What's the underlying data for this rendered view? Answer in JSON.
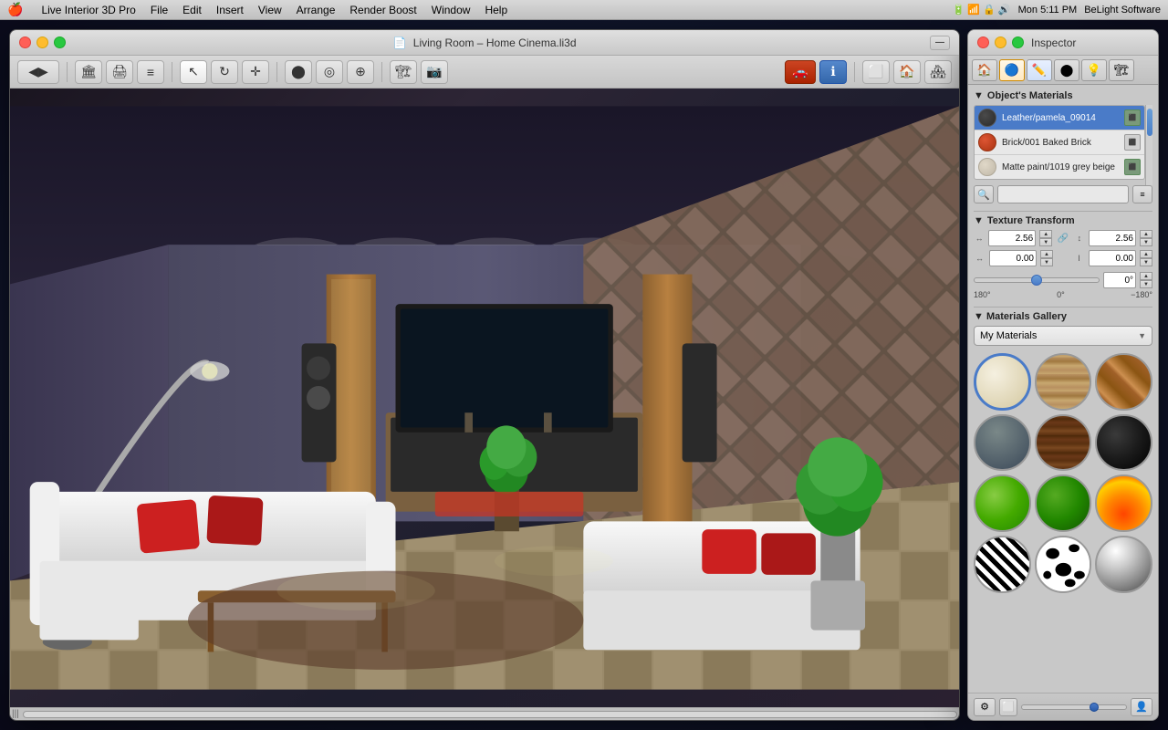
{
  "menubar": {
    "apple": "⌘",
    "app_name": "Live Interior 3D Pro",
    "menus": [
      "File",
      "Edit",
      "Insert",
      "View",
      "Arrange",
      "Render Boost",
      "Window",
      "Help"
    ],
    "right_items": [
      "🔋",
      "📶",
      "Mon 5:11 PM",
      "BeLight Software"
    ],
    "time": "Mon 5:11 PM",
    "brand": "BeLight Software"
  },
  "window": {
    "title": "Living Room – Home Cinema.li3d",
    "traffic_lights": [
      "red",
      "yellow",
      "green"
    ]
  },
  "inspector": {
    "title": "Inspector",
    "traffic_lights": [
      "red",
      "yellow",
      "green"
    ],
    "tabs": [
      "🏠",
      "🔵",
      "✏️",
      "⬤",
      "💡",
      "🏗️"
    ],
    "sections": {
      "materials": {
        "header": "Object's Materials",
        "items": [
          {
            "name": "Leather/pamela_09014",
            "color": "#3a3a3a",
            "type": "leather"
          },
          {
            "name": "Brick/001 Baked Brick",
            "color": "#cc4422",
            "type": "brick"
          },
          {
            "name": "Matte paint/1019 grey beige",
            "color": "#d4c8a8",
            "type": "paint"
          }
        ]
      },
      "texture_transform": {
        "header": "Texture Transform",
        "width_val": "2.56",
        "height_val": "2.56",
        "offset_x": "0.00",
        "offset_y": "0.00",
        "angle": "0°",
        "angle_label_left": "180°",
        "angle_label_center": "0°",
        "angle_label_right": "−180°"
      },
      "gallery": {
        "header": "Materials Gallery",
        "dropdown": "My Materials",
        "items": [
          {
            "name": "cream",
            "class": "mat-cream",
            "selected": true
          },
          {
            "name": "wood-light",
            "class": "mat-wood-light"
          },
          {
            "name": "brick",
            "class": "mat-brick"
          },
          {
            "name": "stone",
            "class": "mat-stone"
          },
          {
            "name": "wood-dark",
            "class": "mat-wood-dark"
          },
          {
            "name": "black",
            "class": "mat-black"
          },
          {
            "name": "green-bright",
            "class": "mat-green-bright"
          },
          {
            "name": "green-dark",
            "class": "mat-green-dark"
          },
          {
            "name": "fire",
            "class": "mat-fire"
          },
          {
            "name": "zebra",
            "class": "mat-zebra"
          },
          {
            "name": "dalmatian",
            "class": "mat-dalmatian"
          },
          {
            "name": "chrome",
            "class": "mat-chrome"
          }
        ]
      }
    }
  },
  "search": {
    "placeholder": ""
  },
  "toolbar": {
    "buttons": [
      "◀▶",
      "🏛️",
      "🖨️",
      "≡",
      "↖",
      "↻",
      "✛",
      "⬤",
      "◎",
      "☊",
      "📷",
      "🏗",
      "ℹ️",
      "⬜",
      "🏠",
      "🏠"
    ]
  }
}
